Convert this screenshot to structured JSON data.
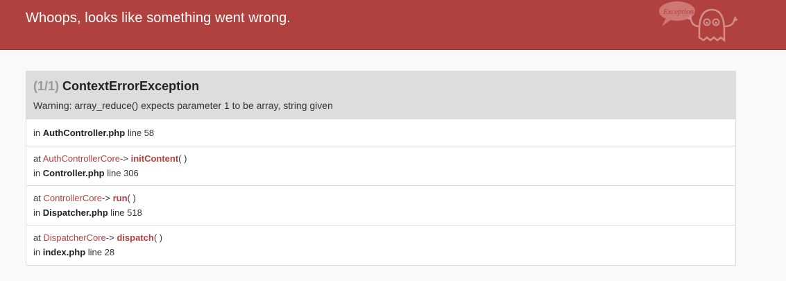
{
  "header": {
    "title": "Whoops, looks like something went wrong.",
    "logo_icon": "ghost-exception-icon",
    "logo_bubble_text": "Exception!",
    "background_color": "#b0413e"
  },
  "exception": {
    "count": "(1/1)",
    "name": "ContextErrorException",
    "message": "Warning: array_reduce() expects parameter 1 to be array, string given"
  },
  "trace": {
    "origin": {
      "prefix": "in",
      "file": "AuthController.php",
      "line_label": "line 58"
    },
    "frames": [
      {
        "at": "at",
        "class": "AuthControllerCore",
        "arrow": "->",
        "function": "initContent",
        "args": "( )",
        "in": "in",
        "file": "Controller.php",
        "line_label": "line 306"
      },
      {
        "at": "at",
        "class": "ControllerCore",
        "arrow": "->",
        "function": "run",
        "args": "( )",
        "in": "in",
        "file": "Dispatcher.php",
        "line_label": "line 518"
      },
      {
        "at": "at",
        "class": "DispatcherCore",
        "arrow": "->",
        "function": "dispatch",
        "args": "( )",
        "in": "in",
        "file": "index.php",
        "line_label": "line 28"
      }
    ]
  }
}
